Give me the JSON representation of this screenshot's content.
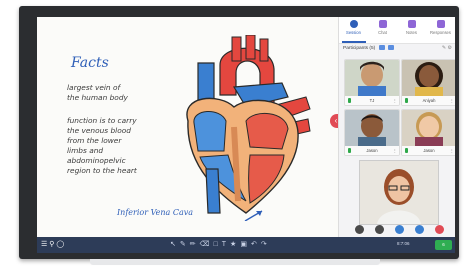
{
  "canvas": {
    "title": "Facts",
    "fact1": "largest vein of the human body",
    "fact2": "function is to carry the venous blood from the lower limbs and abdominopelvic region to the heart",
    "caption": "Inferior Vena Cava"
  },
  "panel": {
    "tabs": [
      {
        "label": "Session",
        "icon": "session-icon"
      },
      {
        "label": "Chat",
        "icon": "chat-icon"
      },
      {
        "label": "Notes",
        "icon": "notes-icon"
      },
      {
        "label": "Responses",
        "icon": "responses-icon"
      }
    ],
    "participants_label": "Participants (5)",
    "tiles": [
      {
        "name": "TJ"
      },
      {
        "name": "Aniyah"
      },
      {
        "name": "Jason"
      },
      {
        "name": "Jason"
      }
    ]
  },
  "toolbar": {
    "timer": "8:7:06",
    "badge": "6"
  },
  "colors": {
    "accent": "#2f5fb8",
    "toolbar": "#2d3c58",
    "live_green": "#2fae52",
    "end_red": "#e14b55"
  }
}
